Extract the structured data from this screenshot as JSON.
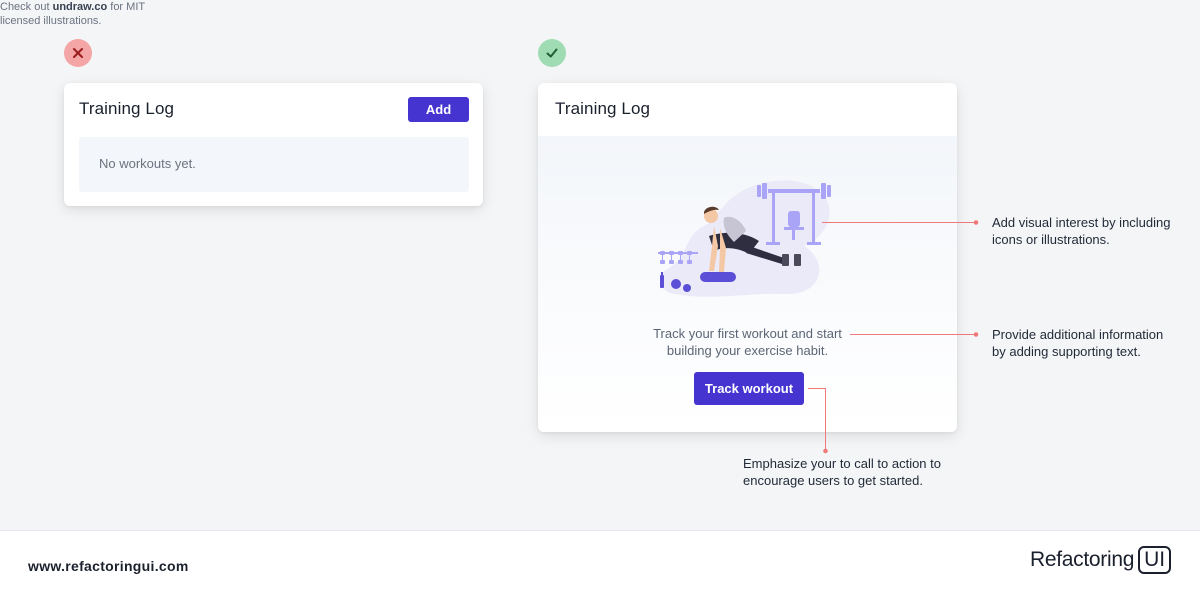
{
  "bad_example": {
    "title": "Training Log",
    "add_label": "Add",
    "empty_text": "No workouts yet."
  },
  "good_example": {
    "title": "Training Log",
    "support_text_line1": "Track your first workout and start",
    "support_text_line2": "building your exercise habit.",
    "cta_label": "Track workout"
  },
  "annotations": {
    "illustration_line1": "Add visual interest by including",
    "illustration_line2": "icons or illustrations.",
    "hint_prefix": "Check out ",
    "hint_link": "undraw.co",
    "hint_suffix": " for MIT",
    "hint_line2": "licensed illustrations.",
    "text_line1": "Provide additional information",
    "text_line2": "by adding supporting text.",
    "cta_line1": "Emphasize your to call to action to",
    "cta_line2": "encourage users to get started."
  },
  "footer": {
    "url": "www.refactoringui.com",
    "logo_text": "Refactoring",
    "logo_ui": "UI"
  },
  "colors": {
    "primary": "#4534d0",
    "accent_line": "#f07a7a",
    "bad_badge": "#f4a5a5",
    "good_badge": "#9fdcb3",
    "illustration": "#a9a4f5"
  }
}
